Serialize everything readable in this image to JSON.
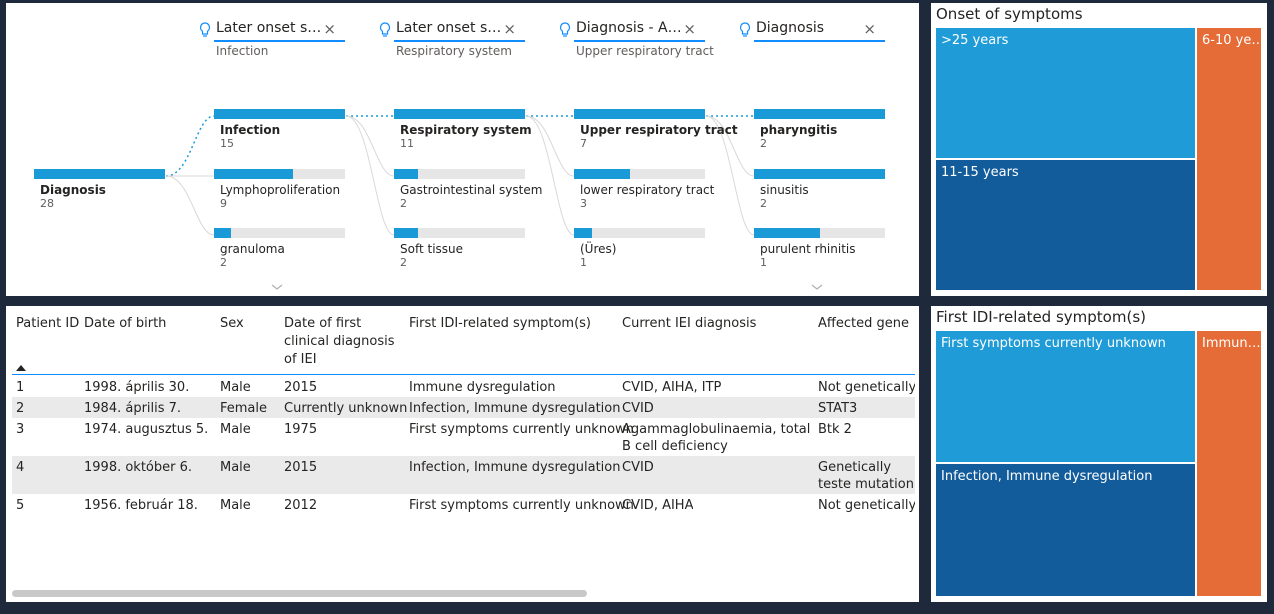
{
  "decomp_tree": {
    "levels": [
      {
        "title": "Later onset symptoms",
        "subtitle": "Infection"
      },
      {
        "title": "Later onset symptoms",
        "subtitle": "Respiratory system"
      },
      {
        "title": "Diagnosis - Area",
        "subtitle": "Upper respiratory tract"
      },
      {
        "title": "Diagnosis",
        "subtitle": ""
      }
    ],
    "root": {
      "label": "Diagnosis",
      "value": "28",
      "fraction": 1.0
    },
    "columns": [
      [
        {
          "label": "Infection",
          "value": "15",
          "fraction": 1.0,
          "selected": true
        },
        {
          "label": "Lymphoproliferation",
          "value": "9",
          "fraction": 0.6
        },
        {
          "label": "granuloma",
          "value": "2",
          "fraction": 0.13
        }
      ],
      [
        {
          "label": "Respiratory system",
          "value": "11",
          "fraction": 1.0,
          "selected": true
        },
        {
          "label": "Gastrointestinal system",
          "value": "2",
          "fraction": 0.18
        },
        {
          "label": "Soft tissue",
          "value": "2",
          "fraction": 0.18
        }
      ],
      [
        {
          "label": "Upper respiratory tract",
          "value": "7",
          "fraction": 1.0,
          "selected": true
        },
        {
          "label": "lower respiratory tract",
          "value": "3",
          "fraction": 0.43
        },
        {
          "label": "(Üres)",
          "value": "1",
          "fraction": 0.14
        }
      ],
      [
        {
          "label": "pharyngitis",
          "value": "2",
          "fraction": 1.0,
          "selected": true
        },
        {
          "label": "sinusitis",
          "value": "2",
          "fraction": 1.0
        },
        {
          "label": "purulent rhinitis",
          "value": "1",
          "fraction": 0.5
        }
      ]
    ]
  },
  "table": {
    "headers": [
      "Patient ID",
      "Date of birth",
      "Sex",
      "Date of first clinical diagnosis of IEI",
      "First IDI-related symptom(s)",
      "Current IEI diagnosis",
      "Affected gene"
    ],
    "rows": [
      [
        "1",
        "1998. április 30.",
        "Male",
        "2015",
        "Immune dysregulation",
        "CVID, AIHA, ITP",
        "Not genetically t"
      ],
      [
        "2",
        "1984. április 7.",
        "Female",
        "Currently unknown",
        "Infection, Immune dysregulation",
        "CVID",
        "STAT3"
      ],
      [
        "3",
        "1974. augusztus 5.",
        "Male",
        "1975",
        "First symptoms currently unknown",
        "Agammaglobulinaemia, total B cell deficiency",
        "Btk 2"
      ],
      [
        "4",
        "1998. október 6.",
        "Male",
        "2015",
        "Infection, Immune dysregulation",
        "CVID",
        "Genetically teste mutation found"
      ],
      [
        "5",
        "1956. február 18.",
        "Male",
        "2012",
        "First symptoms currently unknown",
        "CVID, AIHA",
        "Not genetically t"
      ]
    ]
  },
  "onset_treemap": {
    "title": "Onset of symptoms",
    "cells": [
      {
        "label": ">25 years",
        "color": "#1f9bd7"
      },
      {
        "label": "11-15 years",
        "color": "#125c9b"
      },
      {
        "label": "6-10 ye…",
        "color": "#e66c37"
      }
    ]
  },
  "first_treemap": {
    "title": "First IDI-related symptom(s)",
    "cells": [
      {
        "label": "First symptoms currently unknown",
        "color": "#1f9bd7"
      },
      {
        "label": "Infection, Immune dysregulation",
        "color": "#125c9b"
      },
      {
        "label": "Immun…",
        "color": "#e66c37"
      }
    ]
  },
  "colors": {
    "accent": "#118dff",
    "bar": "#1a9bd7",
    "bar_bg": "#e6e6e6",
    "background": "#1e2a3c"
  }
}
